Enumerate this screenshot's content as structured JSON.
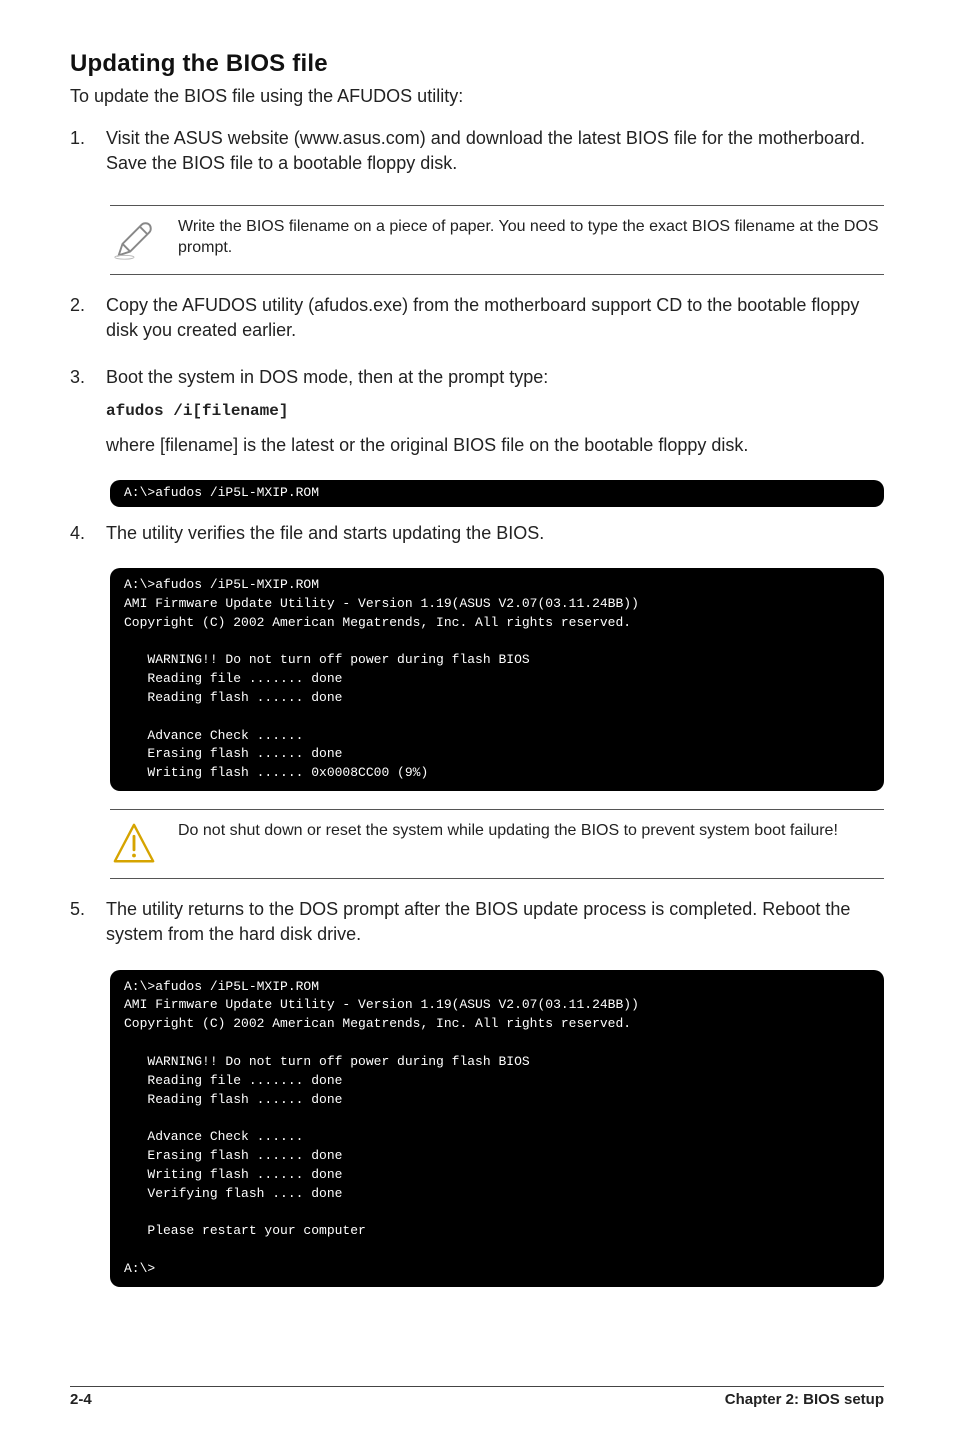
{
  "heading": "Updating the BIOS file",
  "intro": "To update the BIOS file using the AFUDOS utility:",
  "step1_num": "1.",
  "step1": "Visit the ASUS website (www.asus.com) and download the latest BIOS file for the motherboard. Save the BIOS file to a bootable floppy disk.",
  "note1": "Write the BIOS filename on a piece of paper. You need to type the exact BIOS filename at the DOS prompt.",
  "step2_num": "2.",
  "step2": "Copy the AFUDOS utility (afudos.exe) from the motherboard support CD to the bootable floppy disk you created earlier.",
  "step3_num": "3.",
  "step3a": "Boot the system in DOS mode, then at the prompt type:",
  "step3_cmd": "afudos /i[filename]",
  "step3b": "where [filename] is the latest or the original BIOS file on the bootable floppy disk.",
  "term1": "A:\\>afudos /iP5L-MXIP.ROM",
  "step4_num": "4.",
  "step4": "The utility verifies the file and starts updating the BIOS.",
  "term2": "A:\\>afudos /iP5L-MXIP.ROM\nAMI Firmware Update Utility - Version 1.19(ASUS V2.07(03.11.24BB))\nCopyright (C) 2002 American Megatrends, Inc. All rights reserved.\n\n   WARNING!! Do not turn off power during flash BIOS\n   Reading file ....... done\n   Reading flash ...... done\n\n   Advance Check ......\n   Erasing flash ...... done\n   Writing flash ...... 0x0008CC00 (9%)",
  "note2": "Do not shut down or reset the system while updating the BIOS to prevent system boot failure!",
  "step5_num": "5.",
  "step5": "The utility returns to the DOS prompt after the BIOS update process is completed. Reboot the system from the hard disk drive.",
  "term3": "A:\\>afudos /iP5L-MXIP.ROM\nAMI Firmware Update Utility - Version 1.19(ASUS V2.07(03.11.24BB))\nCopyright (C) 2002 American Megatrends, Inc. All rights reserved.\n\n   WARNING!! Do not turn off power during flash BIOS\n   Reading file ....... done\n   Reading flash ...... done\n\n   Advance Check ......\n   Erasing flash ...... done\n   Writing flash ...... done\n   Verifying flash .... done\n\n   Please restart your computer\n\nA:\\>",
  "footer_left": "2-4",
  "footer_right": "Chapter 2: BIOS setup"
}
